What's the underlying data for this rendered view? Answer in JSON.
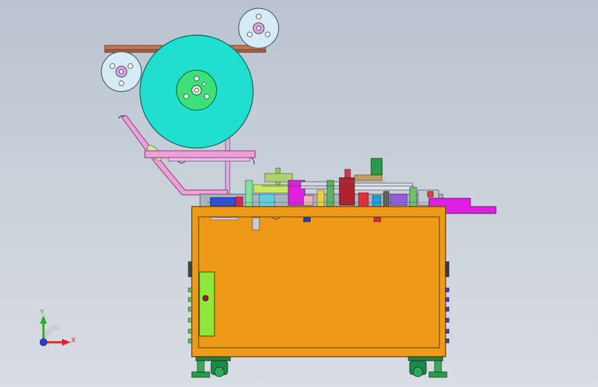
{
  "viewport": {
    "background_top": "#b9c3cf",
    "background_bottom": "#d7dde4"
  },
  "colors": {
    "cabinet": "#ec9a18",
    "cabinet_edge": "#6e4a08",
    "reel": "#1fe0cf",
    "reel_hub": "#3ee07a",
    "small_reel": "#d6ecf4",
    "roller_bar": "#c07a50",
    "guide_arm": "#f0a0d8",
    "magenta_part": "#e020e0",
    "door_panel": "#8ee83a",
    "axis_x": "#e02020",
    "axis_y": "#20b020",
    "axis_z": "#2040e0"
  },
  "triad": {
    "x_label": "X",
    "y_label": "Y"
  }
}
